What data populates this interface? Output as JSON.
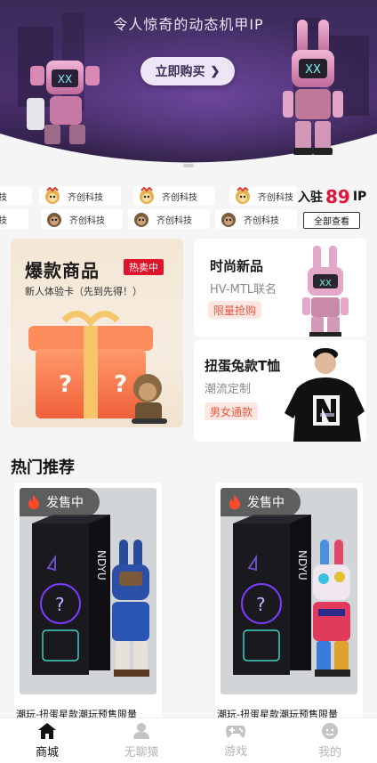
{
  "banner": {
    "title": "令人惊奇的动态机甲IP",
    "button_label": "立即购买"
  },
  "brands": {
    "name": "齐创科技",
    "row1_visible": [
      "技",
      "齐创科技",
      "齐创科技",
      "齐创科技"
    ],
    "row2_visible": [
      "技",
      "齐创科技",
      "齐创科技",
      "齐创科技"
    ],
    "join_prefix": "入驻",
    "join_count": "89",
    "join_suffix": "IP",
    "view_all": "全部查看"
  },
  "promo": {
    "hot": {
      "title": "爆款商品",
      "tag": "热卖中",
      "subtitle": "新人体验卡（先到先得！）"
    },
    "fashion": {
      "title": "时尚新品",
      "subtitle": "HV-MTL联名",
      "pill": "限量抢购"
    },
    "tee": {
      "title": "扭蛋兔款T恤",
      "subtitle": "潮流定制",
      "pill": "男女通款"
    }
  },
  "hot_section": {
    "title": "热门推荐"
  },
  "products": [
    {
      "badge": "发售中",
      "name": "潮玩-扭蛋星款潮玩预售限量"
    },
    {
      "badge": "发售中",
      "name": "潮玩-扭蛋星款潮玩预售限量"
    }
  ],
  "tabbar": [
    {
      "label": "商城",
      "icon": "home-icon",
      "active": true
    },
    {
      "label": "无聊猿",
      "icon": "user-icon",
      "active": false
    },
    {
      "label": "游戏",
      "icon": "gamepad-icon",
      "active": false
    },
    {
      "label": "我的",
      "icon": "profile-icon",
      "active": false
    }
  ],
  "colors": {
    "accent_red": "#e0142c",
    "pill_text": "#e4573d",
    "pill_bg": "#fde7e3",
    "join_number": "#e3143b"
  }
}
